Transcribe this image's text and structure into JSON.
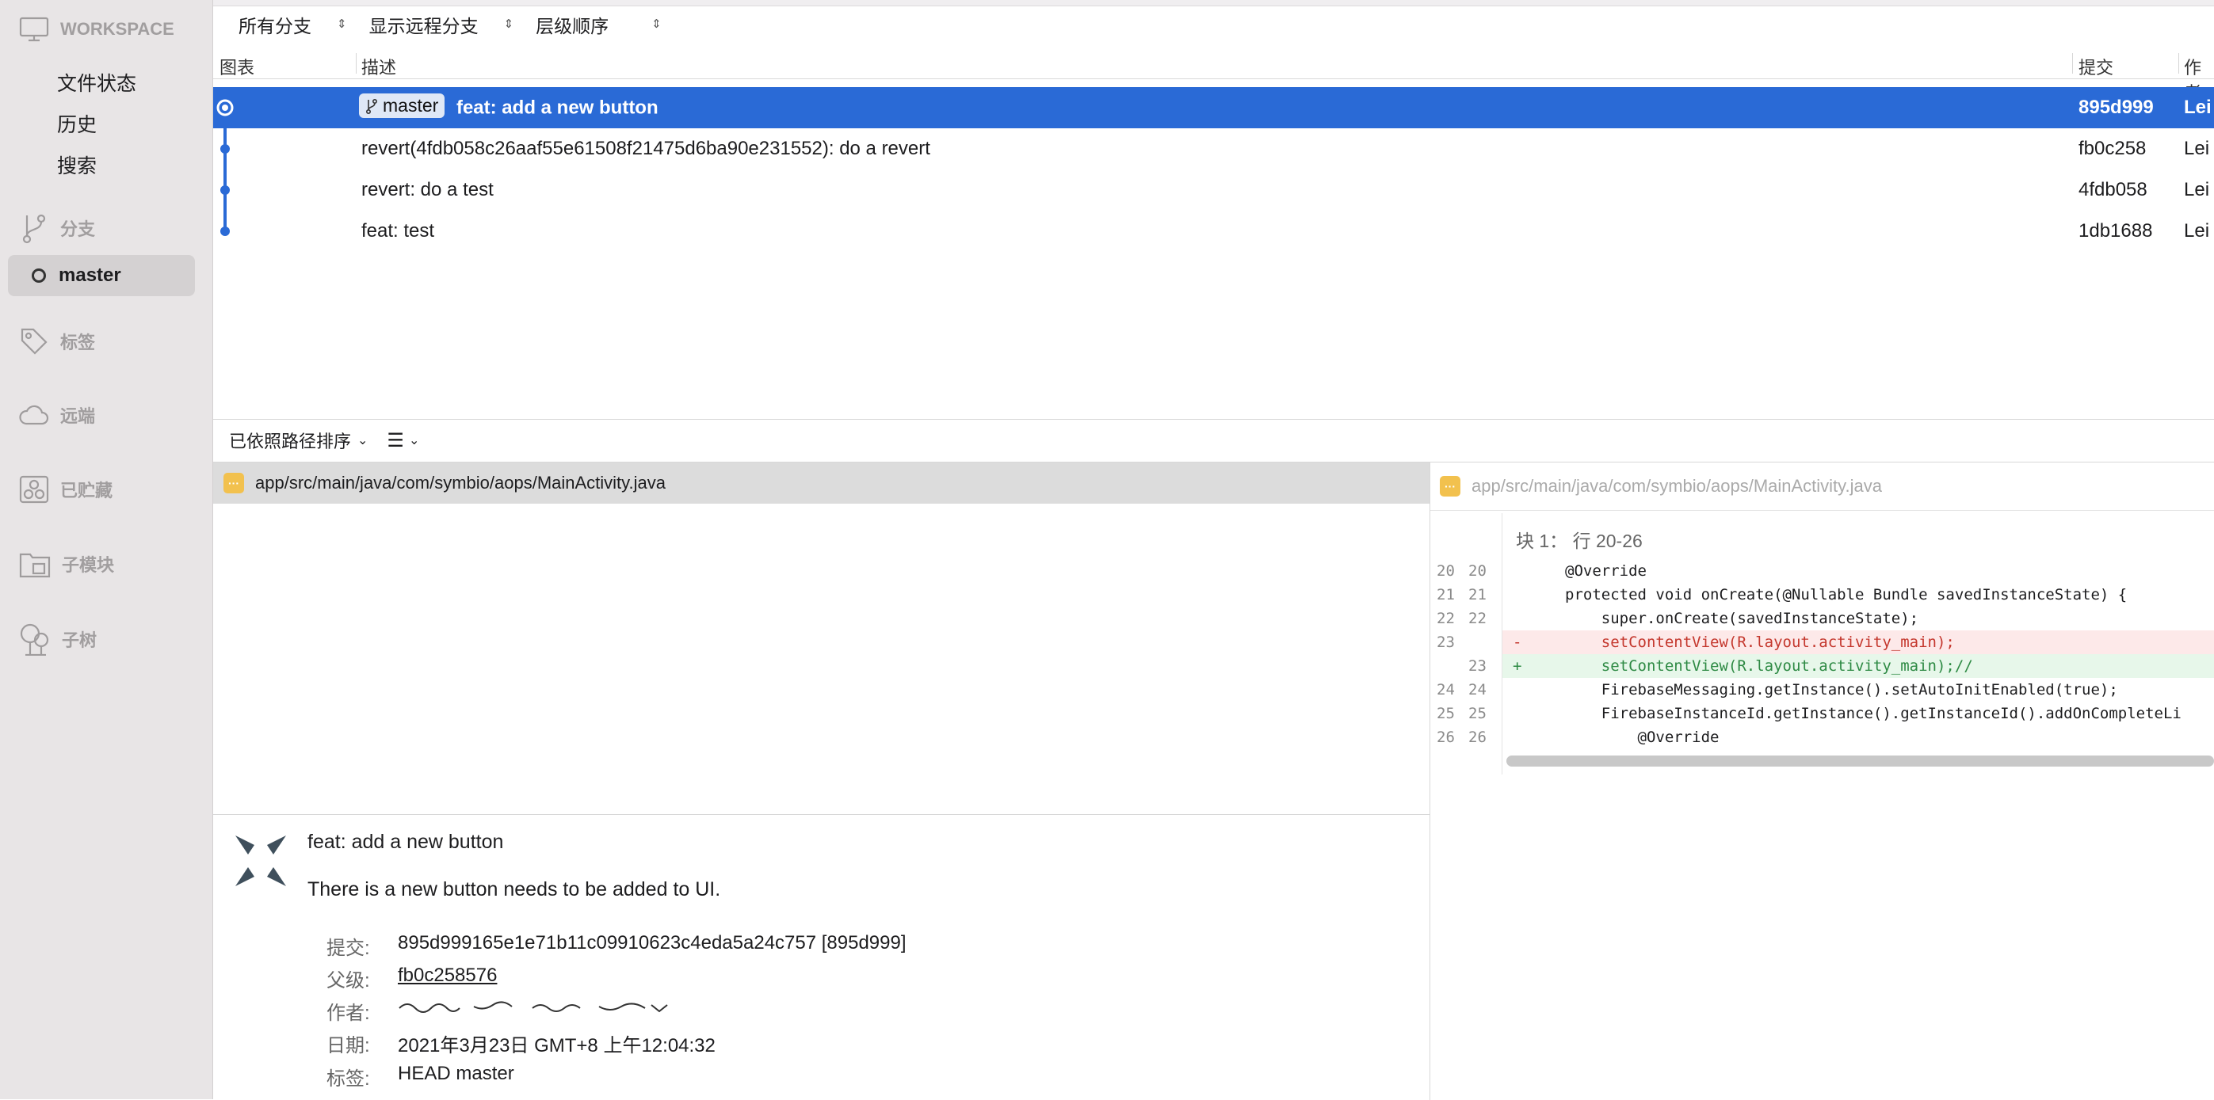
{
  "sidebar": {
    "workspace": "WORKSPACE",
    "items": [
      "文件状态",
      "历史",
      "搜索"
    ],
    "branches_label": "分支",
    "current_branch": "master",
    "tags_label": "标签",
    "remotes_label": "远端",
    "stashes_label": "已贮藏",
    "submodules_label": "子模块",
    "subtrees_label": "子树"
  },
  "toolbar": {
    "branches": "所有分支",
    "remote": "显示远程分支",
    "order": "层级顺序"
  },
  "columns": {
    "graph": "图表",
    "description": "描述",
    "commit": "提交",
    "author": "作者"
  },
  "commits": [
    {
      "badge": "master",
      "desc": "feat: add a new button",
      "hash": "895d999",
      "author": "Lei"
    },
    {
      "desc": "revert(4fdb058c26aaf55e61508f21475d6ba90e231552): do a revert",
      "hash": "fb0c258",
      "author": "Lei"
    },
    {
      "desc": "revert: do a test",
      "hash": "4fdb058",
      "author": "Lei"
    },
    {
      "desc": "feat: test",
      "hash": "1db1688",
      "author": "Lei"
    }
  ],
  "filebar": {
    "sort": "已依照路径排序",
    "list_icon": "list-icon"
  },
  "files": [
    {
      "path": "app/src/main/java/com/symbio/aops/MainActivity.java",
      "icon": "modified-file-icon"
    }
  ],
  "diff": {
    "file": "app/src/main/java/com/symbio/aops/MainActivity.java",
    "hunk": "块 1： 行 20-26",
    "lines": [
      {
        "n1": "20",
        "n2": "20",
        "mark": "",
        "code": "@Override",
        "type": "ctx"
      },
      {
        "n1": "21",
        "n2": "21",
        "mark": "",
        "code": "protected void onCreate(@Nullable Bundle savedInstanceState) {",
        "type": "ctx"
      },
      {
        "n1": "22",
        "n2": "22",
        "mark": "",
        "code": "    super.onCreate(savedInstanceState);",
        "type": "ctx"
      },
      {
        "n1": "23",
        "n2": "",
        "mark": "-",
        "code": "    setContentView(R.layout.activity_main);",
        "type": "del"
      },
      {
        "n1": "",
        "n2": "23",
        "mark": "+",
        "code": "    setContentView(R.layout.activity_main);//",
        "type": "add"
      },
      {
        "n1": "24",
        "n2": "24",
        "mark": "",
        "code": "    FirebaseMessaging.getInstance().setAutoInitEnabled(true);",
        "type": "ctx"
      },
      {
        "n1": "25",
        "n2": "25",
        "mark": "",
        "code": "    FirebaseInstanceId.getInstance().getInstanceId().addOnCompleteLi",
        "type": "ctx"
      },
      {
        "n1": "26",
        "n2": "26",
        "mark": "",
        "code": "        @Override",
        "type": "ctx"
      }
    ]
  },
  "detail": {
    "subject": "feat: add a new button",
    "body": "There is a new button needs to be added to UI.",
    "commit_label": "提交:",
    "commit_value": "895d999165e1e71b11c09910623c4eda5a24c757 [895d999]",
    "parent_label": "父级:",
    "parent_value": "fb0c258576",
    "author_label": "作者:",
    "date_label": "日期:",
    "date_value": "2021年3月23日 GMT+8 上午12:04:32",
    "tags_label": "标签:",
    "tags_value": "HEAD master"
  },
  "colors": {
    "selection": "#2a6ad6",
    "graph": "#2a6ad6",
    "sidebar": "#e8e5e6"
  }
}
